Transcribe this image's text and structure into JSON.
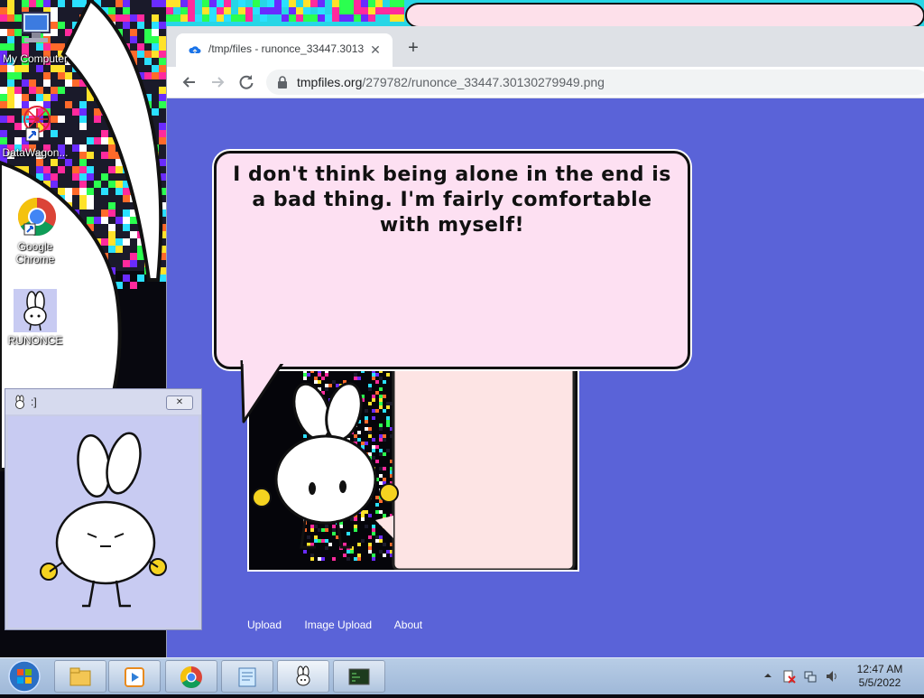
{
  "desktop": {
    "icons": [
      {
        "label": "My Computer",
        "icon": "computer-icon"
      },
      {
        "label": "DataWagon...",
        "icon": "datawagon-icon"
      },
      {
        "label": "Google Chrome",
        "icon": "chrome-icon"
      },
      {
        "label": "RUNONCE",
        "icon": "bunny-icon"
      }
    ]
  },
  "browser": {
    "tab_title": "/tmp/files - runonce_33447.3013",
    "tab_close": "✕",
    "new_tab": "+",
    "url_host": "tmpfiles.org",
    "url_path": "/279782/runonce_33447.30130279949.png",
    "page": {
      "speech_text": "I don't think being alone in the end is a bad thing. I'm fairly comfortable with myself!",
      "footer_links": [
        "Upload",
        "Image Upload",
        "About"
      ]
    }
  },
  "mini_window": {
    "title": ":]",
    "close": "✕"
  },
  "taskbar": {
    "items": [
      "explorer-icon",
      "media-player-icon",
      "chrome-icon",
      "notepad-icon",
      "bunny-icon",
      "terminal-icon"
    ],
    "clock_time": "12:47 AM",
    "clock_date": "5/5/2022"
  },
  "colors": {
    "page_bg": "#5a63d8",
    "speech_bg": "#fde0f2",
    "mini_bg": "#c8cbf2"
  }
}
